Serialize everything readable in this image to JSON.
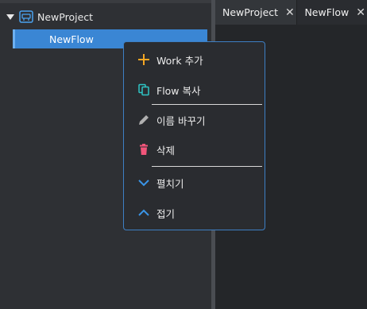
{
  "tree": {
    "project_label": "NewProject",
    "flow_label": "NewFlow"
  },
  "tabs": [
    {
      "label": "NewProject",
      "close": "✕"
    },
    {
      "label": "NewFlow",
      "close": "✕"
    }
  ],
  "context_menu": {
    "items": [
      {
        "label": "Work 추가",
        "icon": "plus-icon",
        "color": "#f5a623"
      },
      {
        "label": "Flow 복사",
        "icon": "copy-icon",
        "color": "#2ec4c4"
      },
      {
        "label": "이름 바꾸기",
        "icon": "pencil-icon",
        "color": "#b0b0b0"
      },
      {
        "label": "삭제",
        "icon": "trash-icon",
        "color": "#f2557a"
      },
      {
        "label": "펼치기",
        "icon": "chevron-down-icon",
        "color": "#3a95e8"
      },
      {
        "label": "접기",
        "icon": "chevron-up-icon",
        "color": "#3a95e8"
      }
    ]
  },
  "colors": {
    "accent": "#3a86d4",
    "menu_border": "#3d7fc4"
  }
}
